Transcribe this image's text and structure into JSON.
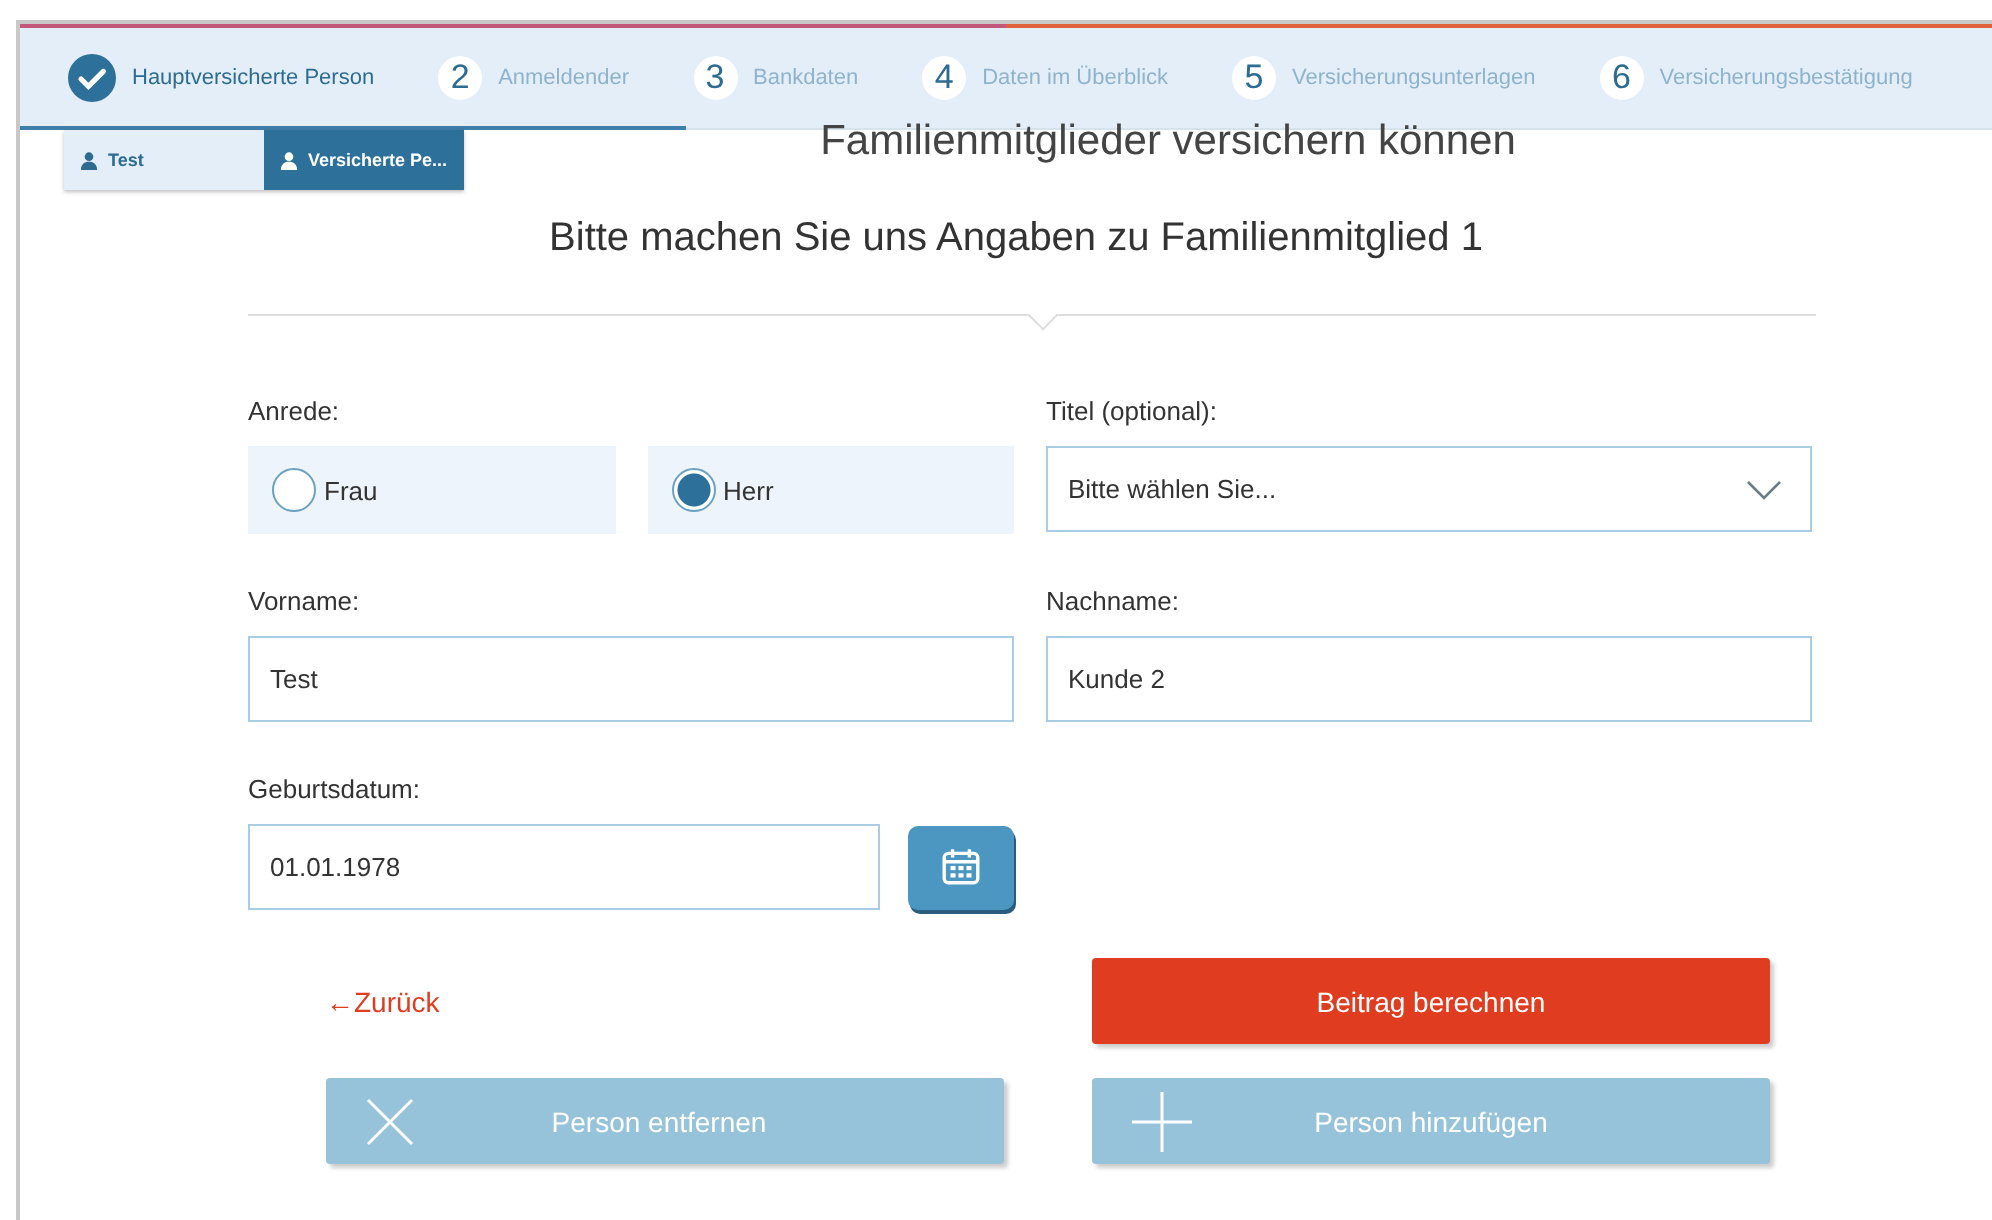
{
  "steps": [
    {
      "label": "Hauptversicherte Person",
      "completed": true
    },
    {
      "number": "2",
      "label": "Anmeldender",
      "completed": false
    },
    {
      "number": "3",
      "label": "Bankdaten",
      "completed": false
    },
    {
      "number": "4",
      "label": "Daten im Überblick",
      "completed": false
    },
    {
      "number": "5",
      "label": "Versicherungsunterlagen",
      "completed": false
    },
    {
      "number": "6",
      "label": "Versicherungsbestätigung",
      "completed": false
    }
  ],
  "person_tabs": [
    {
      "label": "Test",
      "selected": false
    },
    {
      "label": "Versicherte Pe...",
      "selected": true
    }
  ],
  "heading": "Familienmitglieder versichern können",
  "subheading": "Bitte machen Sie uns Angaben zu Familienmitglied 1",
  "form": {
    "salutation": {
      "label": "Anrede:",
      "options": [
        {
          "label": "Frau",
          "selected": false
        },
        {
          "label": "Herr",
          "selected": true
        }
      ]
    },
    "title": {
      "label": "Titel (optional):",
      "value": "Bitte wählen Sie..."
    },
    "first_name": {
      "label": "Vorname:",
      "value": "Test"
    },
    "last_name": {
      "label": "Nachname:",
      "value": "Kunde 2"
    },
    "birthdate": {
      "label": "Geburtsdatum:",
      "value": "01.01.1978"
    }
  },
  "back_link": "←Zurück",
  "buttons": [
    {
      "label": "Beitrag berechnen",
      "kind": "primary"
    },
    {
      "label": "Person entfernen",
      "kind": "remove"
    },
    {
      "label": "Person hinzufügen",
      "kind": "add"
    }
  ]
}
